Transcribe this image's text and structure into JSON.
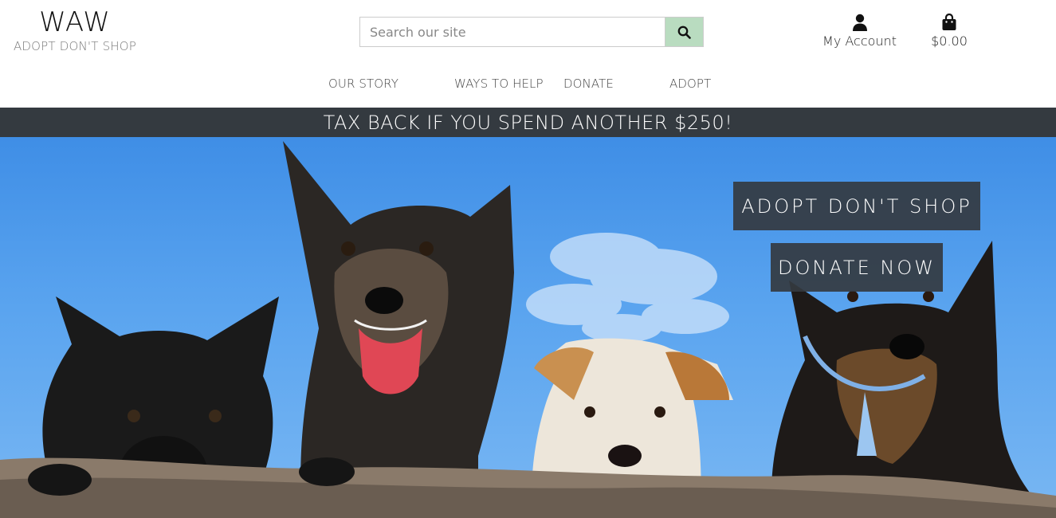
{
  "brand": {
    "title": "WAW",
    "tagline": "ADOPT DON'T SHOP"
  },
  "search": {
    "placeholder": "Search our site",
    "value": "",
    "button_icon": "search-icon"
  },
  "account": {
    "label": "My Account",
    "icon": "user-icon"
  },
  "cart": {
    "total": "$0.00",
    "icon": "shopping-bag-icon"
  },
  "nav": {
    "items": [
      {
        "label": "OUR STORY"
      },
      {
        "label": "WAYS TO HELP"
      },
      {
        "label": "DONATE"
      },
      {
        "label": "ADOPT"
      }
    ]
  },
  "banner": {
    "text": "TAX BACK IF YOU SPEND ANOTHER $250!"
  },
  "hero": {
    "image": "four-dogs-peeking-over-wall-photo",
    "buttons": {
      "adopt": "ADOPT DON'T SHOP",
      "donate": "DONATE NOW"
    }
  },
  "colors": {
    "banner_bg": "#343a40",
    "search_button_bg": "#b9dcc0",
    "sky": "#5aa4ef",
    "text_muted": "#777777"
  }
}
